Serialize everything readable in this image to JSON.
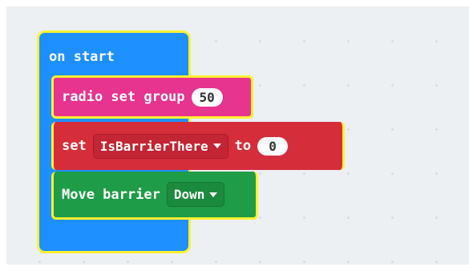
{
  "workspace": {
    "background_color": "#ecf0f3",
    "on_start": {
      "label": "on start",
      "color": "#1e90ff",
      "highlight_color": "#fff12f"
    },
    "blocks": {
      "radio_set_group": {
        "label": "radio set group",
        "value": "50",
        "color": "#e6348f"
      },
      "set_variable": {
        "label": "set",
        "variable": "IsBarrierThere",
        "to_label": "to",
        "value": "0",
        "color": "#d62d3b"
      },
      "move_barrier": {
        "label": "Move barrier",
        "direction": "Down",
        "color": "#1f9c47"
      }
    },
    "icons": {
      "dropdown_arrow": "dropdown-arrow-icon"
    }
  }
}
